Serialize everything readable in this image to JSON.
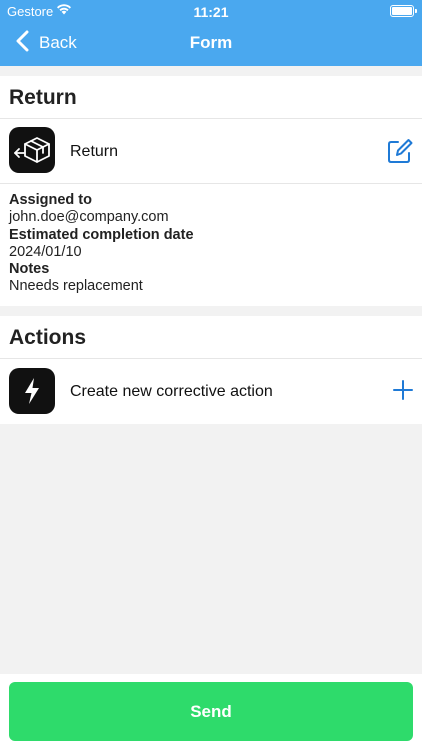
{
  "status_bar": {
    "carrier": "Gestore",
    "time": "11:21"
  },
  "nav": {
    "back_label": "Back",
    "title": "Form"
  },
  "return_section": {
    "title": "Return",
    "item_label": "Return",
    "assigned_to_label": "Assigned to",
    "assigned_to_value": "john.doe@company.com",
    "completion_label": "Estimated completion date",
    "completion_value": "2024/01/10",
    "notes_label": "Notes",
    "notes_value": "Nneeds replacement"
  },
  "actions_section": {
    "title": "Actions",
    "create_label": "Create new corrective action"
  },
  "send_button": {
    "label": "Send"
  },
  "colors": {
    "header": "#4aa8ef",
    "accent": "#1f7ad6",
    "send": "#2edb6b"
  }
}
